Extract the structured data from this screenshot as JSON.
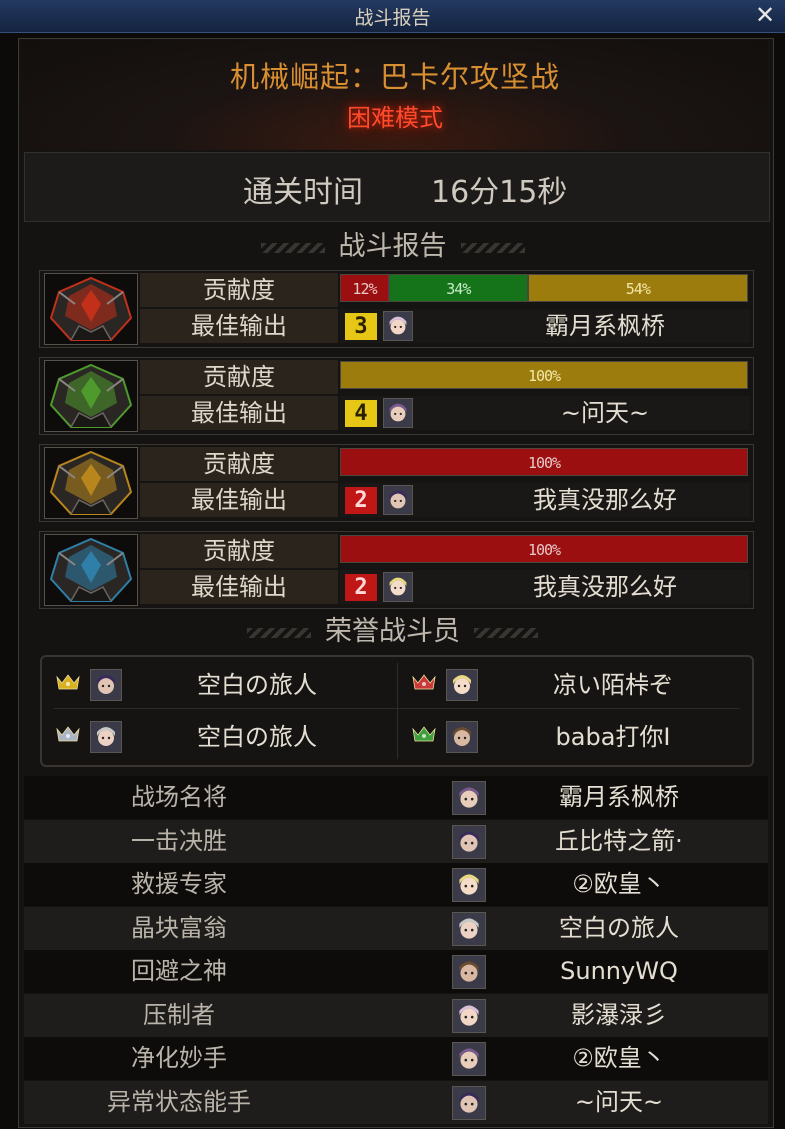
{
  "window": {
    "title": "战斗报告",
    "close_icon": "close-icon"
  },
  "header": {
    "dungeon": "机械崛起：巴卡尔攻坚战",
    "mode": "困难模式"
  },
  "clear": {
    "label": "通关时间",
    "value": "16分15秒"
  },
  "section_report": "战斗报告",
  "section_honor": "荣誉战斗员",
  "row_labels": {
    "contribution": "贡献度",
    "best": "最佳输出"
  },
  "bosses": [
    {
      "icon": "red-boss-helm-icon",
      "color": "#c2301a",
      "contribution": [
        {
          "label": "12%",
          "value": 12,
          "color": "red"
        },
        {
          "label": "34%",
          "value": 34,
          "color": "green"
        },
        {
          "label": "54%",
          "value": 54,
          "color": "gold"
        }
      ],
      "rank": "3",
      "rank_color": "yellow",
      "player": "霸月系枫桥"
    },
    {
      "icon": "green-boss-helm-icon",
      "color": "#4f9a2c",
      "contribution": [
        {
          "label": "100%",
          "value": 100,
          "color": "gold"
        }
      ],
      "rank": "4",
      "rank_color": "yellow",
      "player": "~问天~"
    },
    {
      "icon": "gold-boss-helm-icon",
      "color": "#b8861c",
      "contribution": [
        {
          "label": "100%",
          "value": 100,
          "color": "red"
        }
      ],
      "rank": "2",
      "rank_color": "red",
      "player": "我真没那么好"
    },
    {
      "icon": "blue-boss-helm-icon",
      "color": "#2f7fa8",
      "contribution": [
        {
          "label": "100%",
          "value": 100,
          "color": "red"
        }
      ],
      "rank": "2",
      "rank_color": "red",
      "player": "我真没那么好"
    }
  ],
  "honor": [
    {
      "crown": "gold-crown-icon",
      "crown_color": "#d8b020",
      "player": "空白の旅人"
    },
    {
      "crown": "red-crown-icon",
      "crown_color": "#c83a3a",
      "player": "凉い陌桛ぞ"
    },
    {
      "crown": "silver-crown-icon",
      "crown_color": "#aab4c4",
      "player": "空白の旅人"
    },
    {
      "crown": "green-crown-icon",
      "crown_color": "#3ca03c",
      "player": "baba打你I"
    }
  ],
  "awards": [
    {
      "title": "战场名将",
      "player": "霸月系枫桥"
    },
    {
      "title": "一击决胜",
      "player": "丘比特之箭·"
    },
    {
      "title": "救援专家",
      "player": "②欧皇丶"
    },
    {
      "title": "晶块富翁",
      "player": "空白の旅人"
    },
    {
      "title": "回避之神",
      "player": "SunnyWQ"
    },
    {
      "title": "压制者",
      "player": "影瀑渌彡"
    },
    {
      "title": "净化妙手",
      "player": "②欧皇丶"
    },
    {
      "title": "异常状态能手",
      "player": "~问天~"
    }
  ]
}
